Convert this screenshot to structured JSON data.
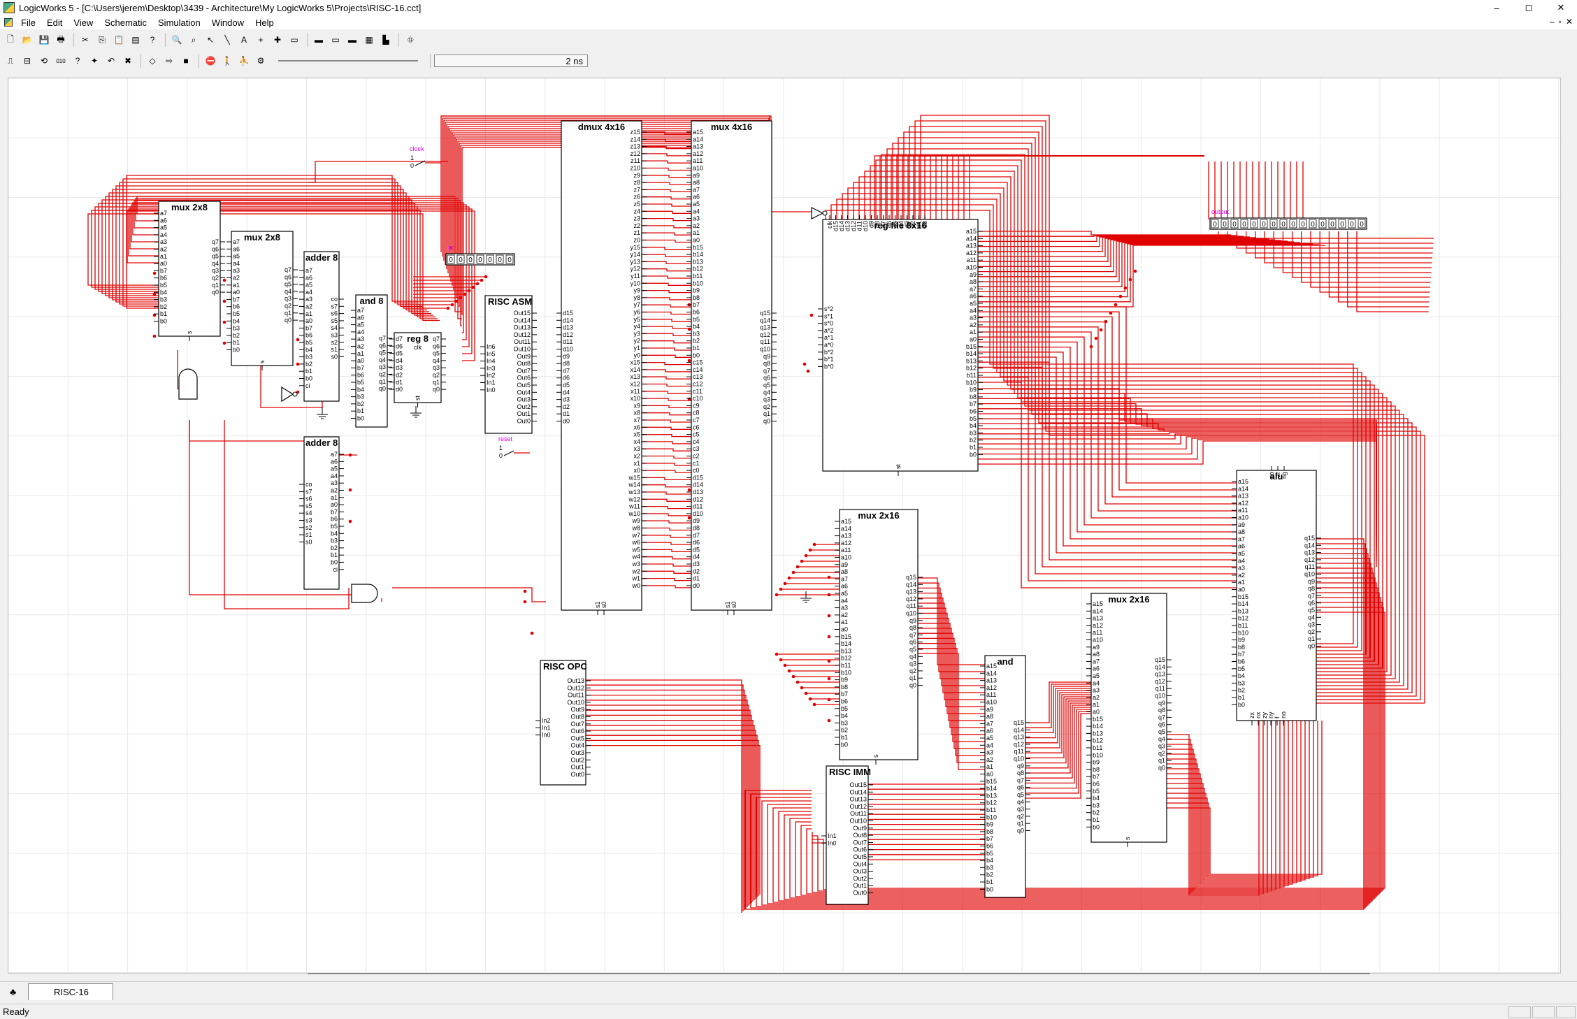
{
  "window": {
    "title": "LogicWorks 5 - [C:\\Users\\jerem\\Desktop\\3439 - Architecture\\My LogicWorks 5\\Projects\\RISC-16.cct]",
    "controls": [
      "–",
      "◻",
      "✕"
    ],
    "mdi_controls": [
      "–",
      "▫",
      "✕"
    ]
  },
  "menu": [
    "File",
    "Edit",
    "View",
    "Schematic",
    "Simulation",
    "Window",
    "Help"
  ],
  "toolbar1": [
    {
      "name": "new-icon",
      "glyph": "🗋"
    },
    {
      "name": "open-icon",
      "glyph": "📂"
    },
    {
      "name": "save-icon",
      "glyph": "💾"
    },
    {
      "name": "print-icon",
      "glyph": "🖶"
    },
    {
      "name": "cut-icon",
      "glyph": "✂"
    },
    {
      "name": "copy-icon",
      "glyph": "⎘"
    },
    {
      "name": "paste-icon",
      "glyph": "📋"
    },
    {
      "name": "clipboard-icon",
      "glyph": "▤"
    },
    {
      "name": "help-icon",
      "glyph": "?"
    },
    {
      "name": "zoom-icon",
      "glyph": "🔍"
    },
    {
      "name": "magnify-icon",
      "glyph": "⌕"
    },
    {
      "name": "pointer-icon",
      "glyph": "↖"
    },
    {
      "name": "wire-icon",
      "glyph": "╲"
    },
    {
      "name": "text-icon",
      "glyph": "A"
    },
    {
      "name": "crosshair-icon",
      "glyph": "+"
    },
    {
      "name": "add-icon",
      "glyph": "✚"
    },
    {
      "name": "panel-icon",
      "glyph": "▭"
    },
    {
      "name": "panel2-icon",
      "glyph": "▬"
    },
    {
      "name": "panel3-icon",
      "glyph": "▭"
    },
    {
      "name": "panel4-icon",
      "glyph": "▬"
    },
    {
      "name": "chip-icon",
      "glyph": "▦"
    },
    {
      "name": "bar-chart-icon",
      "glyph": "▙"
    },
    {
      "name": "network-icon",
      "glyph": "⛗"
    }
  ],
  "toolbar2": [
    {
      "name": "timing-icon",
      "glyph": "⎍"
    },
    {
      "name": "probe-icon",
      "glyph": "⊟"
    },
    {
      "name": "clock-icon",
      "glyph": "⟲"
    },
    {
      "name": "binary-icon",
      "glyph": "010"
    },
    {
      "name": "query-icon",
      "glyph": "?"
    },
    {
      "name": "spark-icon",
      "glyph": "✦"
    },
    {
      "name": "undo-icon",
      "glyph": "↶"
    },
    {
      "name": "delete-icon",
      "glyph": "✖"
    },
    {
      "name": "step-icon",
      "glyph": "◇"
    },
    {
      "name": "run-icon",
      "glyph": "⇨"
    },
    {
      "name": "stop-icon",
      "glyph": "■"
    },
    {
      "name": "reset-icon",
      "glyph": "⛔"
    },
    {
      "name": "walk-icon",
      "glyph": "🚶"
    },
    {
      "name": "run-fast-icon",
      "glyph": "⛹"
    },
    {
      "name": "settings-icon",
      "glyph": "⚙"
    }
  ],
  "simulation_time": "2 ns",
  "tab_label": "RISC-16",
  "status": "Ready",
  "wire_color": "#e00000",
  "components": {
    "mux_a": {
      "title": "mux 2x8",
      "left": [
        "a7",
        "a6",
        "a5",
        "a4",
        "a3",
        "a2",
        "a1",
        "a0",
        "b7",
        "b6",
        "b5",
        "b4",
        "b3",
        "b2",
        "b1",
        "b0"
      ],
      "right": [
        "q7",
        "q6",
        "q5",
        "q4",
        "q3",
        "q2",
        "q1",
        "q0"
      ],
      "bottom": "s"
    },
    "mux_b": {
      "title": "mux 2x8",
      "left": [
        "a7",
        "a6",
        "a5",
        "a4",
        "a3",
        "a2",
        "a1",
        "a0",
        "b7",
        "b6",
        "b5",
        "b4",
        "b3",
        "b2",
        "b1",
        "b0"
      ],
      "right": [
        "q7",
        "q6",
        "q5",
        "q4",
        "q3",
        "q2",
        "q1",
        "q0"
      ],
      "bottom": "s"
    },
    "adder_top": {
      "title": "adder 8",
      "left": [
        "a7",
        "a6",
        "a5",
        "a4",
        "a3",
        "a2",
        "a1",
        "a0",
        "b7",
        "b6",
        "b5",
        "b4",
        "b3",
        "b2",
        "b1",
        "b0",
        "ci"
      ],
      "right": [
        "co",
        "s7",
        "s6",
        "s5",
        "s4",
        "s3",
        "s2",
        "s1",
        "s0"
      ]
    },
    "adder_bot": {
      "title": "adder 8",
      "left": [
        "co",
        "s7",
        "s6",
        "s5",
        "s4",
        "s3",
        "s2",
        "s1",
        "s0"
      ],
      "right": [
        "a7",
        "a6",
        "a5",
        "a4",
        "a3",
        "a2",
        "a1",
        "a0",
        "b7",
        "b6",
        "b5",
        "b4",
        "b3",
        "b2",
        "b1",
        "b0",
        "ci"
      ]
    },
    "and8": {
      "title": "and 8",
      "left": [
        "a7",
        "a6",
        "a5",
        "a4",
        "a3",
        "a2",
        "a1",
        "a0",
        "b7",
        "b6",
        "b5",
        "b4",
        "b3",
        "b2",
        "b1",
        "b0"
      ],
      "right": [
        "q7",
        "q6",
        "q5",
        "q4",
        "q3",
        "q2",
        "q1",
        "q0"
      ]
    },
    "reg8": {
      "title": "reg 8",
      "left": [
        "d7",
        "d6",
        "d5",
        "d4",
        "d3",
        "d2",
        "d1",
        "d0"
      ],
      "right": [
        "q7",
        "q6",
        "q5",
        "q4",
        "q3",
        "q2",
        "q1",
        "q0"
      ],
      "top": "clk",
      "bottom": "st"
    },
    "risc_asm": {
      "title": "RISC ASM",
      "left": [
        "In6",
        "In5",
        "In4",
        "In3",
        "In2",
        "In1",
        "In0"
      ],
      "right": [
        "Out15",
        "Out14",
        "Out13",
        "Out12",
        "Out11",
        "Out10",
        "Out9",
        "Out8",
        "Out7",
        "Out6",
        "Out5",
        "Out4",
        "Out3",
        "Out2",
        "Out1",
        "Out0"
      ]
    },
    "dmux": {
      "title": "dmux 4x16",
      "left": [
        "d15",
        "d14",
        "d13",
        "d12",
        "d11",
        "d10",
        "d9",
        "d8",
        "d7",
        "d6",
        "d5",
        "d4",
        "d3",
        "d2",
        "d1",
        "d0"
      ],
      "right_a": [
        "z15",
        "z14",
        "z13",
        "z12",
        "z11",
        "z10",
        "z9",
        "z8",
        "z7",
        "z6",
        "z5",
        "z4",
        "z3",
        "z2",
        "z1",
        "z0",
        "y15",
        "y14",
        "y13",
        "y12",
        "y11",
        "y10",
        "y9",
        "y8",
        "y7",
        "y6",
        "y5",
        "y4",
        "y3",
        "y2",
        "y1",
        "y0",
        "x15",
        "x14",
        "x13",
        "x12",
        "x11",
        "x10",
        "x9",
        "x8",
        "x7",
        "x6",
        "x5",
        "x4",
        "x3",
        "x2",
        "x1",
        "x0",
        "w15",
        "w14",
        "w13",
        "w12",
        "w11",
        "w10",
        "w9",
        "w8",
        "w7",
        "w6",
        "w5",
        "w4",
        "w3",
        "w2",
        "w1",
        "w0"
      ],
      "bottom": [
        "s1",
        "s0"
      ]
    },
    "mux4": {
      "title": "mux 4x16",
      "left": [
        "a15",
        "a14",
        "a13",
        "a12",
        "a11",
        "a10",
        "a9",
        "a8",
        "a7",
        "a6",
        "a5",
        "a4",
        "a3",
        "a2",
        "a1",
        "a0",
        "b15",
        "b14",
        "b13",
        "b12",
        "b11",
        "b10",
        "b9",
        "b8",
        "b7",
        "b6",
        "b5",
        "b4",
        "b3",
        "b2",
        "b1",
        "b0",
        "c15",
        "c14",
        "c13",
        "c12",
        "c11",
        "c10",
        "c9",
        "c8",
        "c7",
        "c6",
        "c5",
        "c4",
        "c3",
        "c2",
        "c1",
        "c0",
        "d15",
        "d14",
        "d13",
        "d12",
        "d11",
        "d10",
        "d9",
        "d8",
        "d7",
        "d6",
        "d5",
        "d4",
        "d3",
        "d2",
        "d1",
        "d0"
      ],
      "right": [
        "q15",
        "q14",
        "q13",
        "q12",
        "q11",
        "q10",
        "q9",
        "q8",
        "q7",
        "q6",
        "q5",
        "q4",
        "q3",
        "q2",
        "q1",
        "q0"
      ],
      "bottom": [
        "s1",
        "s0"
      ]
    },
    "regfile": {
      "title": "reg file 8x16",
      "top": [
        "clk",
        "d15",
        "d14",
        "d13",
        "d12",
        "d11",
        "d10",
        "d9",
        "d8",
        "d7",
        "d6",
        "d5",
        "d4",
        "d3",
        "d2",
        "d1",
        "d0"
      ],
      "left": [
        "s*2",
        "s*1",
        "s*0",
        "a*2",
        "a*1",
        "a*0",
        "b*2",
        "b*1",
        "b*0"
      ],
      "right": [
        "a15",
        "a14",
        "a13",
        "a12",
        "a11",
        "a10",
        "a9",
        "a8",
        "a7",
        "a6",
        "a5",
        "a4",
        "a3",
        "a2",
        "a1",
        "a0",
        "b15",
        "b14",
        "b13",
        "b12",
        "b11",
        "b10",
        "b9",
        "b8",
        "b7",
        "b6",
        "b5",
        "b4",
        "b3",
        "b2",
        "b1",
        "b0"
      ],
      "bottom": "st"
    },
    "mux2x16_mid": {
      "title": "mux 2x16",
      "left": [
        "a15",
        "a14",
        "a13",
        "a12",
        "a11",
        "a10",
        "a9",
        "a8",
        "a7",
        "a6",
        "a5",
        "a4",
        "a3",
        "a2",
        "a1",
        "a0",
        "b15",
        "b14",
        "b13",
        "b12",
        "b11",
        "b10",
        "b9",
        "b8",
        "b7",
        "b6",
        "b5",
        "b4",
        "b3",
        "b2",
        "b1",
        "b0"
      ],
      "right": [
        "q15",
        "q14",
        "q13",
        "q12",
        "q11",
        "q10",
        "q9",
        "q8",
        "q7",
        "q6",
        "q5",
        "q4",
        "q3",
        "q2",
        "q1",
        "q0"
      ],
      "bottom": "s"
    },
    "risc_opc": {
      "title": "RISC OPC",
      "left": [
        "In2",
        "In1",
        "In0"
      ],
      "right": [
        "Out13",
        "Out12",
        "Out11",
        "Out10",
        "Out9",
        "Out8",
        "Out7",
        "Out6",
        "Out5",
        "Out4",
        "Out3",
        "Out2",
        "Out1",
        "Out0"
      ]
    },
    "risc_imm": {
      "title": "RISC IMM",
      "left": [
        "In1",
        "In0"
      ],
      "right": [
        "Out15",
        "Out14",
        "Out13",
        "Out12",
        "Out11",
        "Out10",
        "Out9",
        "Out8",
        "Out7",
        "Out6",
        "Out5",
        "Out4",
        "Out3",
        "Out2",
        "Out1",
        "Out0"
      ]
    },
    "and16": {
      "title": "and",
      "left": [
        "a15",
        "a14",
        "a13",
        "a12",
        "a11",
        "a10",
        "a9",
        "a8",
        "a7",
        "a6",
        "a5",
        "a4",
        "a3",
        "a2",
        "a1",
        "a0",
        "b15",
        "b14",
        "b13",
        "b12",
        "b11",
        "b10",
        "b9",
        "b8",
        "b7",
        "b6",
        "b5",
        "b4",
        "b3",
        "b2",
        "b1",
        "b0"
      ],
      "right": [
        "q15",
        "q14",
        "q13",
        "q12",
        "q11",
        "q10",
        "q9",
        "q8",
        "q7",
        "q6",
        "q5",
        "q4",
        "q3",
        "q2",
        "q1",
        "q0"
      ]
    },
    "mux2x16_right": {
      "title": "mux 2x16",
      "left": [
        "a15",
        "a14",
        "a13",
        "a12",
        "a11",
        "a10",
        "a9",
        "a8",
        "a7",
        "a6",
        "a5",
        "a4",
        "a3",
        "a2",
        "a1",
        "a0",
        "b15",
        "b14",
        "b13",
        "b12",
        "b11",
        "b10",
        "b9",
        "b8",
        "b7",
        "b6",
        "b5",
        "b4",
        "b3",
        "b2",
        "b1",
        "b0"
      ],
      "right": [
        "q15",
        "q14",
        "q13",
        "q12",
        "q11",
        "q10",
        "q9",
        "q8",
        "q7",
        "q6",
        "q5",
        "q4",
        "q3",
        "q2",
        "q1",
        "q0"
      ],
      "bottom": "s"
    },
    "alu": {
      "title": "alu",
      "top": [
        "co",
        "zr",
        "ng"
      ],
      "left": [
        "a15",
        "a14",
        "a13",
        "a12",
        "a11",
        "a10",
        "a9",
        "a8",
        "a7",
        "a6",
        "a5",
        "a4",
        "a3",
        "a2",
        "a1",
        "a0",
        "b15",
        "b14",
        "b13",
        "b12",
        "b11",
        "b10",
        "b9",
        "b8",
        "b7",
        "b6",
        "b5",
        "b4",
        "b3",
        "b2",
        "b1",
        "b0"
      ],
      "right": [
        "q15",
        "q14",
        "q13",
        "q12",
        "q11",
        "q10",
        "q9",
        "q8",
        "q7",
        "q6",
        "q5",
        "q4",
        "q3",
        "q2",
        "q1",
        "q0"
      ],
      "bottom": [
        "zx",
        "nx",
        "zy",
        "ny",
        "f",
        "no"
      ]
    }
  },
  "pc_display": {
    "label": "pc",
    "digits": [
      "0",
      "0",
      "0",
      "0",
      "0",
      "0",
      "0"
    ]
  },
  "output_display": {
    "label": "output",
    "digits": [
      "0",
      "0",
      "0",
      "0",
      "0",
      "0",
      "0",
      "0",
      "0",
      "0",
      "0",
      "0",
      "0",
      "0",
      "0",
      "0"
    ]
  },
  "clock_switch": {
    "label": "clock",
    "states": [
      "1",
      "0"
    ]
  },
  "reset_switch": {
    "label": "reset",
    "states": [
      "1",
      "0"
    ]
  }
}
